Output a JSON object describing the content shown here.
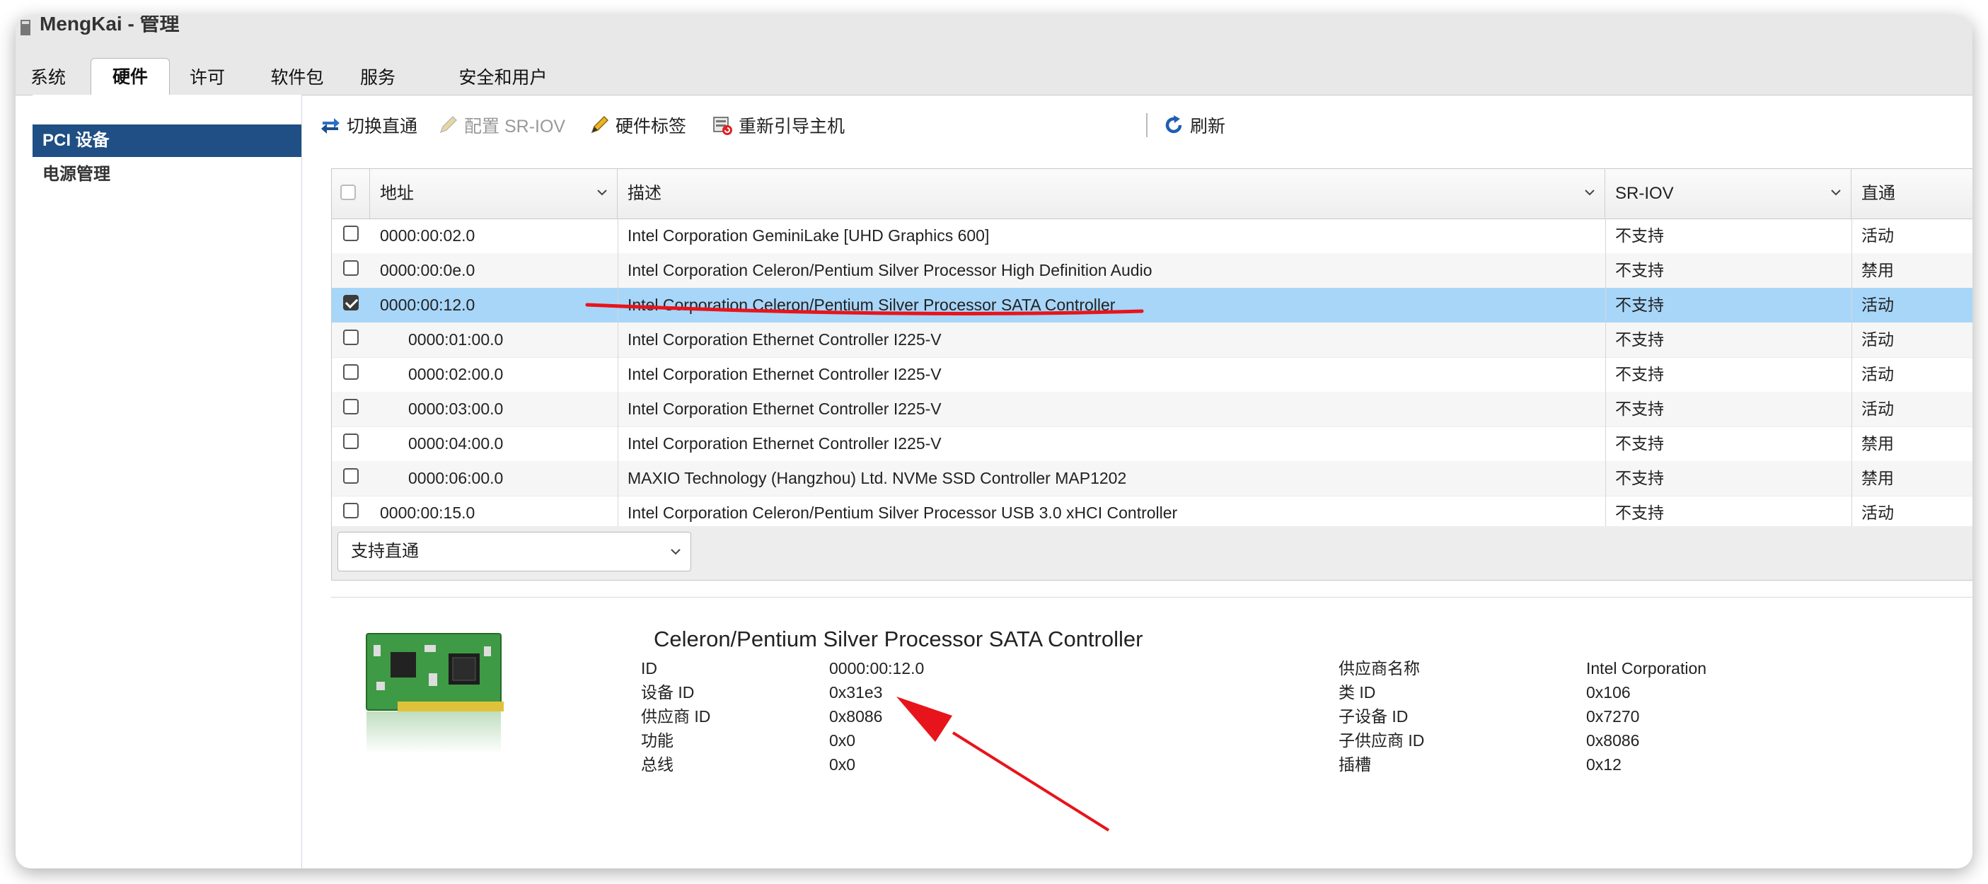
{
  "window": {
    "title": "MengKai - 管理"
  },
  "tabs": [
    {
      "label": "系统"
    },
    {
      "label": "硬件",
      "active": true
    },
    {
      "label": "许可"
    },
    {
      "label": "软件包"
    },
    {
      "label": "服务"
    },
    {
      "label": "安全和用户"
    }
  ],
  "sidebar": {
    "items": [
      {
        "label": "PCI 设备",
        "selected": true
      },
      {
        "label": "电源管理"
      }
    ]
  },
  "toolbar": {
    "toggle_passthrough": "切换直通",
    "configure_sriov": "配置 SR-IOV",
    "hardware_label": "硬件标签",
    "reboot_host": "重新引导主机",
    "refresh": "刷新",
    "icons": [
      "passthrough-toggle-icon",
      "pencil-icon",
      "pencil-icon",
      "reboot-host-icon",
      "refresh-icon"
    ]
  },
  "table": {
    "columns": {
      "address": "地址",
      "description": "描述",
      "sriov": "SR-IOV",
      "passthrough": "直通"
    },
    "rows": [
      {
        "address": "0000:00:02.0",
        "description": "Intel Corporation GeminiLake [UHD Graphics 600]",
        "sriov": "不支持",
        "passthrough": "活动",
        "checked": false,
        "indent": false
      },
      {
        "address": "0000:00:0e.0",
        "description": "Intel Corporation Celeron/Pentium Silver Processor High Definition Audio",
        "sriov": "不支持",
        "passthrough": "禁用",
        "checked": false,
        "indent": false
      },
      {
        "address": "0000:00:12.0",
        "description": "Intel Corporation Celeron/Pentium Silver Processor SATA Controller",
        "sriov": "不支持",
        "passthrough": "活动",
        "checked": true,
        "indent": false
      },
      {
        "address": "0000:01:00.0",
        "description": "Intel Corporation Ethernet Controller I225-V",
        "sriov": "不支持",
        "passthrough": "活动",
        "checked": false,
        "indent": true
      },
      {
        "address": "0000:02:00.0",
        "description": "Intel Corporation Ethernet Controller I225-V",
        "sriov": "不支持",
        "passthrough": "活动",
        "checked": false,
        "indent": true
      },
      {
        "address": "0000:03:00.0",
        "description": "Intel Corporation Ethernet Controller I225-V",
        "sriov": "不支持",
        "passthrough": "活动",
        "checked": false,
        "indent": true
      },
      {
        "address": "0000:04:00.0",
        "description": "Intel Corporation Ethernet Controller I225-V",
        "sriov": "不支持",
        "passthrough": "禁用",
        "checked": false,
        "indent": true
      },
      {
        "address": "0000:06:00.0",
        "description": "MAXIO Technology (Hangzhou) Ltd. NVMe SSD Controller MAP1202",
        "sriov": "不支持",
        "passthrough": "禁用",
        "checked": false,
        "indent": true
      },
      {
        "address": "0000:00:15.0",
        "description": "Intel Corporation Celeron/Pentium Silver Processor USB 3.0 xHCI Controller",
        "sriov": "不支持",
        "passthrough": "活动",
        "checked": false,
        "indent": false
      }
    ]
  },
  "filter": {
    "selected": "支持直通"
  },
  "detail": {
    "title": "Celeron/Pentium Silver Processor SATA Controller",
    "left": [
      {
        "label": "ID",
        "value": "0000:00:12.0"
      },
      {
        "label": "设备 ID",
        "value": "0x31e3"
      },
      {
        "label": "供应商 ID",
        "value": "0x8086"
      },
      {
        "label": "功能",
        "value": "0x0"
      },
      {
        "label": "总线",
        "value": "0x0"
      }
    ],
    "right": [
      {
        "label": "供应商名称",
        "value": "Intel Corporation"
      },
      {
        "label": "类 ID",
        "value": "0x106"
      },
      {
        "label": "子设备 ID",
        "value": "0x7270"
      },
      {
        "label": "子供应商 ID",
        "value": "0x8086"
      },
      {
        "label": "插槽",
        "value": "0x12"
      }
    ]
  },
  "colors": {
    "selected_nav": "#1f4f84",
    "selected_row": "#a7d6f9",
    "annotation_red": "#e8141b"
  }
}
